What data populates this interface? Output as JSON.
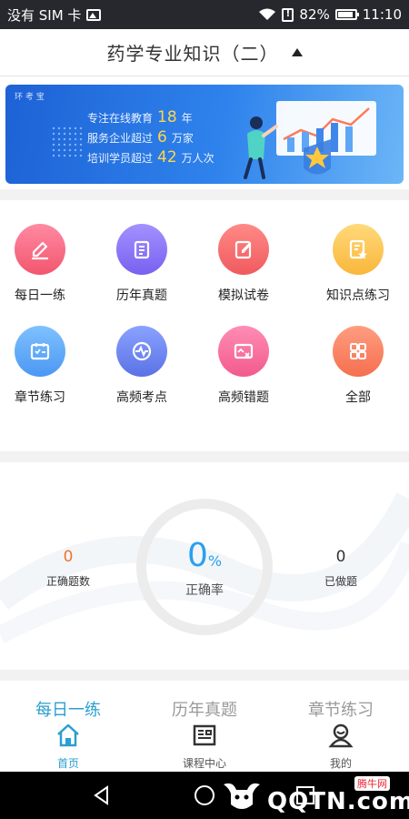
{
  "status_bar": {
    "carrier": "没有 SIM 卡",
    "battery": "82%",
    "time": "11:10",
    "icons": [
      "image-icon",
      "wifi-icon",
      "alert-icon",
      "battery-icon"
    ]
  },
  "header": {
    "title": "药学专业知识（二）",
    "toggle_icon": "triangle-up-icon"
  },
  "banner": {
    "brand": "环 考 宝",
    "lines": [
      {
        "pre": "专注在线教育",
        "num": "18",
        "post": "年"
      },
      {
        "pre": "服务企业超过",
        "num": "6",
        "post": "万家"
      },
      {
        "pre": "培训学员超过",
        "num": "42",
        "post": "万人次"
      }
    ]
  },
  "features": [
    {
      "label": "每日一练",
      "icon": "pencil-icon",
      "color_top": "#ff8aa2",
      "color_bottom": "#f2566e"
    },
    {
      "label": "历年真题",
      "icon": "clipboard-icon",
      "color_top": "#a391ff",
      "color_bottom": "#7861f0"
    },
    {
      "label": "模拟试卷",
      "icon": "edit-paper-icon",
      "color_top": "#ff8a86",
      "color_bottom": "#f05a5f"
    },
    {
      "label": "知识点练习",
      "icon": "doc-star-icon",
      "color_top": "#ffd97a",
      "color_bottom": "#f9b73b"
    },
    {
      "label": "章节练习",
      "icon": "checklist-icon",
      "color_top": "#7fc1ff",
      "color_bottom": "#4b98f3"
    },
    {
      "label": "高频考点",
      "icon": "target-icon",
      "color_top": "#8aa2ff",
      "color_bottom": "#5b72e6"
    },
    {
      "label": "高频错题",
      "icon": "error-card-icon",
      "color_top": "#ff8db5",
      "color_bottom": "#f25a8c"
    },
    {
      "label": "全部",
      "icon": "grid-icon",
      "color_top": "#ff9d80",
      "color_bottom": "#f56f4f"
    }
  ],
  "stats": {
    "correct_count": {
      "value": "0",
      "label": "正确题数",
      "color": "#f0722e"
    },
    "rate": {
      "value": "0",
      "unit": "%",
      "label": "正确率",
      "color": "#2aa0ee"
    },
    "done_count": {
      "value": "0",
      "label": "已做题",
      "color": "#333333"
    }
  },
  "tabs": [
    {
      "label": "每日一练",
      "sub": "首页",
      "icon": "home-icon",
      "active": true
    },
    {
      "label": "历年真题",
      "sub": "课程中心",
      "icon": "book-icon",
      "active": false
    },
    {
      "label": "章节练习",
      "sub": "我的",
      "icon": "user-icon",
      "active": false
    }
  ],
  "watermark": {
    "top": "腾牛网",
    "main": "QQTN.com"
  },
  "colors": {
    "accent": "#2a9fd0",
    "banner": "#2f83ec"
  }
}
